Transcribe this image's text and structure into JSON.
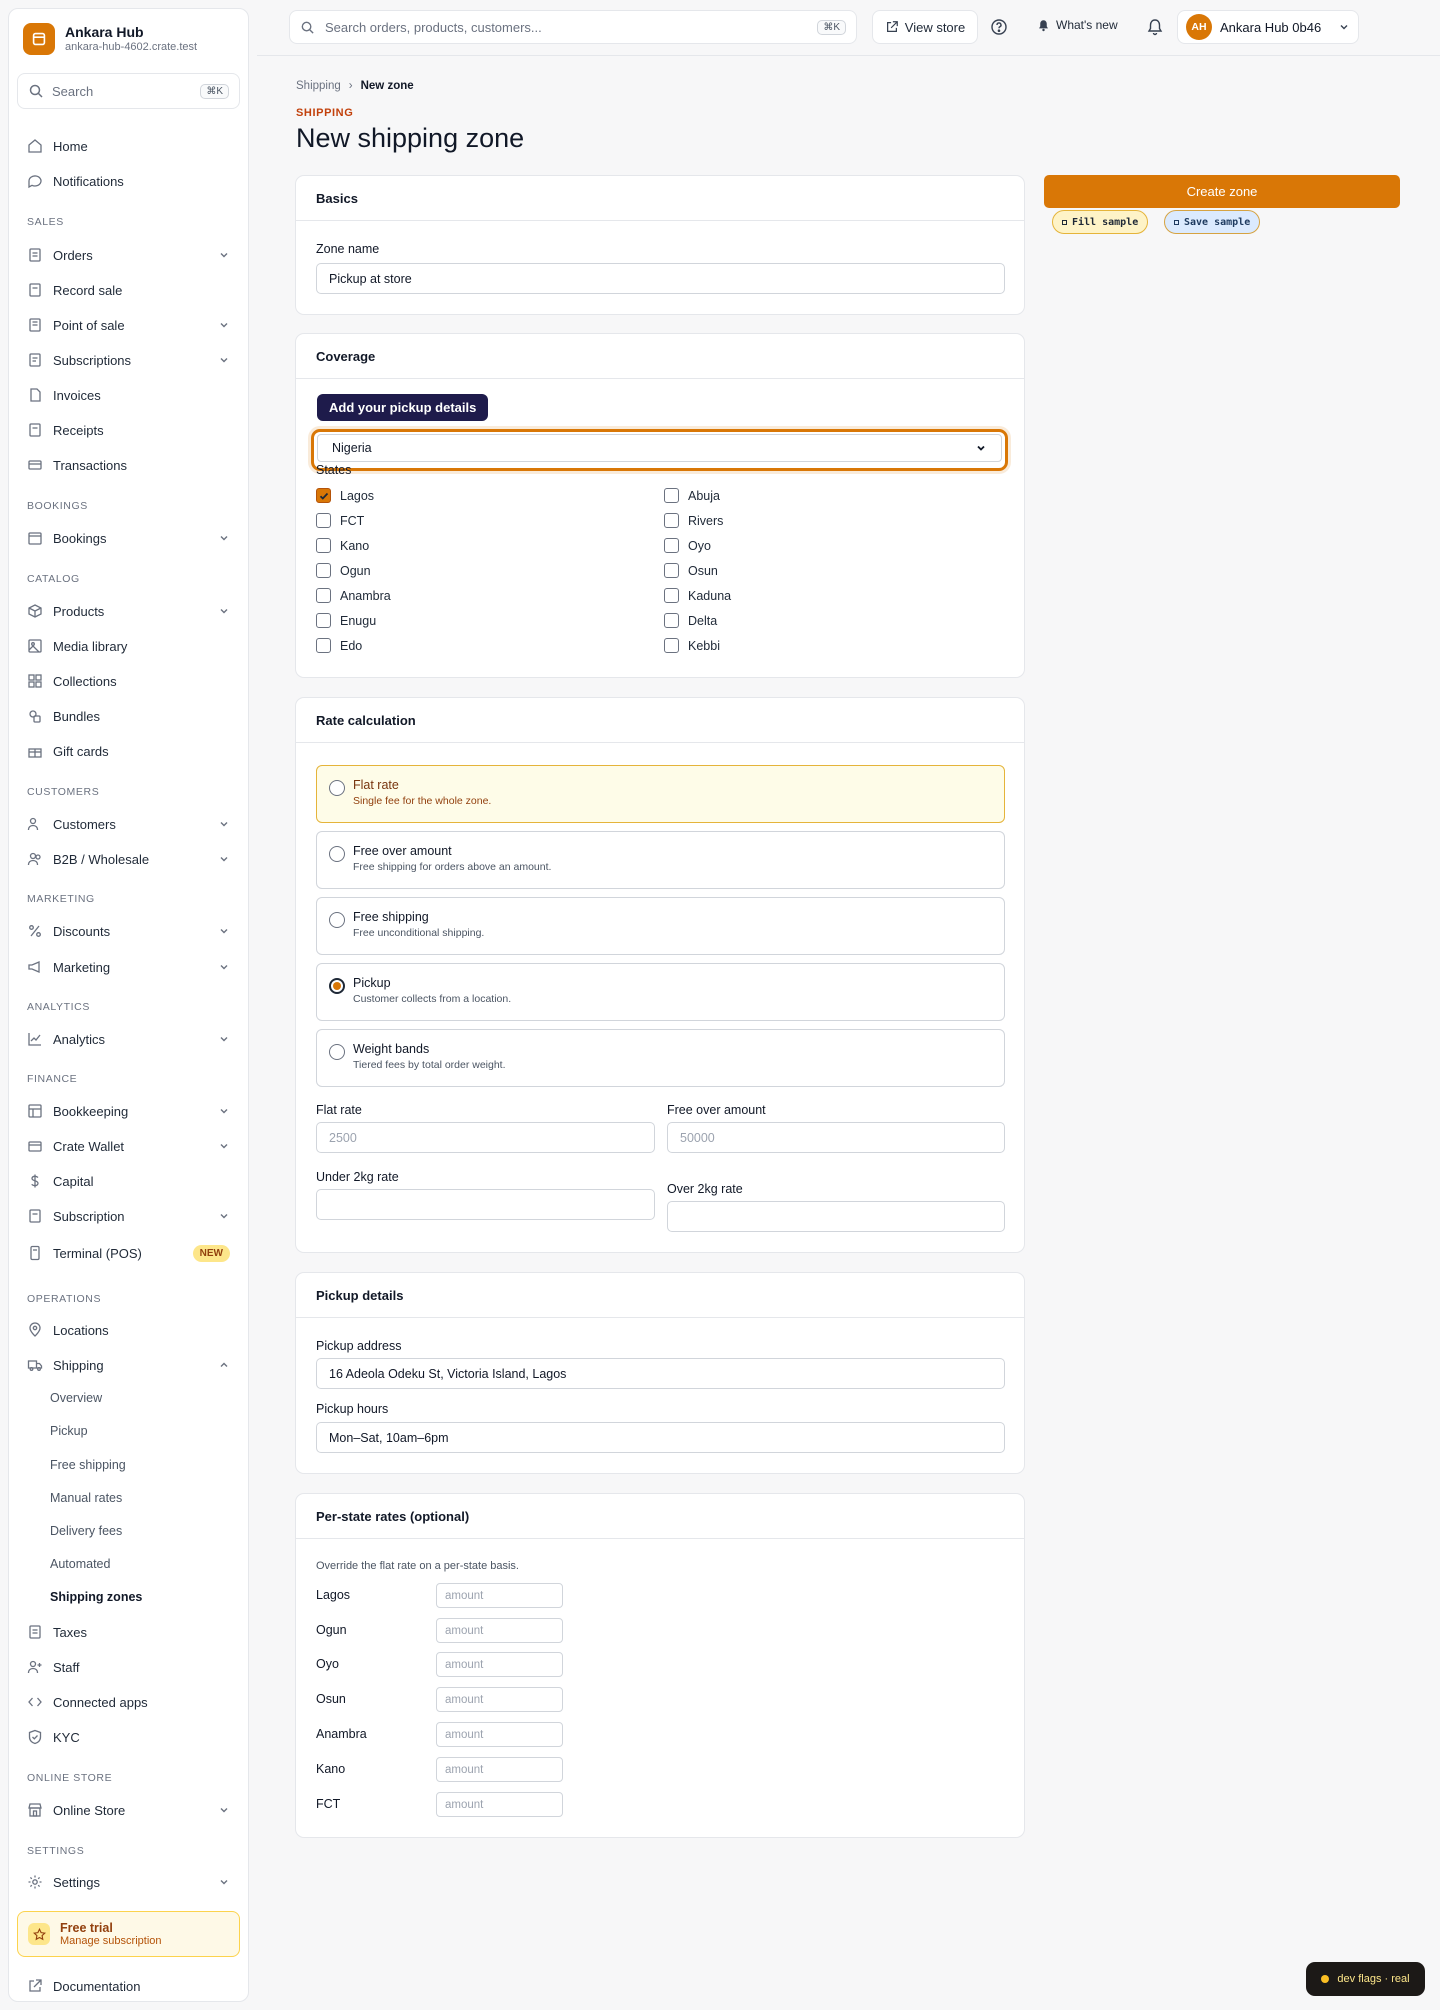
{
  "brand": {
    "name": "Ankara Hub",
    "url": "ankara-hub-4602.crate.test"
  },
  "sidebar_search": {
    "placeholder": "Search",
    "shortcut": "⌘K"
  },
  "nav": {
    "home": "Home",
    "notifications": "Notifications",
    "sec_sales": "SALES",
    "orders": "Orders",
    "record_sale": "Record sale",
    "point_of_sale": "Point of sale",
    "subscriptions": "Subscriptions",
    "invoices": "Invoices",
    "receipts": "Receipts",
    "transactions": "Transactions",
    "sec_bookings": "BOOKINGS",
    "bookings": "Bookings",
    "sec_catalog": "CATALOG",
    "products": "Products",
    "media_library": "Media library",
    "collections": "Collections",
    "bundles": "Bundles",
    "gift_cards": "Gift cards",
    "sec_customers": "CUSTOMERS",
    "customers": "Customers",
    "b2b": "B2B / Wholesale",
    "sec_marketing": "MARKETING",
    "discounts": "Discounts",
    "marketing": "Marketing",
    "sec_analytics": "ANALYTICS",
    "analytics": "Analytics",
    "sec_finance": "FINANCE",
    "bookkeeping": "Bookkeeping",
    "crate_wallet": "Crate Wallet",
    "capital": "Capital",
    "subscription": "Subscription",
    "terminal": "Terminal (POS)",
    "terminal_badge": "NEW",
    "sec_operations": "OPERATIONS",
    "locations": "Locations",
    "shipping": "Shipping",
    "shipping_sub": [
      "Overview",
      "Pickup",
      "Free shipping",
      "Manual rates",
      "Delivery fees",
      "Automated",
      "Shipping zones"
    ],
    "taxes": "Taxes",
    "staff": "Staff",
    "connected_apps": "Connected apps",
    "kyc": "KYC",
    "sec_online_store": "ONLINE STORE",
    "online_store": "Online Store",
    "sec_settings": "SETTINGS",
    "settings": "Settings",
    "documentation": "Documentation"
  },
  "trial": {
    "title": "Free trial",
    "subtitle": "Manage subscription"
  },
  "topbar": {
    "search_placeholder": "Search orders, products, customers...",
    "search_shortcut": "⌘K",
    "view_store": "View store",
    "whats_new": "What's new",
    "account_name": "Ankara Hub 0b46",
    "avatar_initials": "AH"
  },
  "breadcrumb": {
    "parent": "Shipping",
    "separator": "›",
    "current": "New zone"
  },
  "page": {
    "eyebrow": "SHIPPING",
    "title": "New shipping zone"
  },
  "basics": {
    "heading": "Basics",
    "zone_name_label": "Zone name",
    "zone_name_value": "Pickup at store"
  },
  "coverage": {
    "heading": "Coverage",
    "tooltip": "Add your pickup details",
    "country": "Nigeria",
    "states_label": "States",
    "states_left": [
      "Lagos",
      "FCT",
      "Kano",
      "Ogun",
      "Anambra",
      "Enugu",
      "Edo"
    ],
    "states_right": [
      "Abuja",
      "Rivers",
      "Oyo",
      "Osun",
      "Kaduna",
      "Delta",
      "Kebbi"
    ],
    "checked": [
      "Lagos"
    ]
  },
  "rate": {
    "heading": "Rate calculation",
    "options": [
      {
        "title": "Flat rate",
        "desc": "Single fee for the whole zone."
      },
      {
        "title": "Free over amount",
        "desc": "Free shipping for orders above an amount."
      },
      {
        "title": "Free shipping",
        "desc": "Free unconditional shipping."
      },
      {
        "title": "Pickup",
        "desc": "Customer collects from a location."
      },
      {
        "title": "Weight bands",
        "desc": "Tiered fees by total order weight."
      }
    ],
    "selected": "Pickup",
    "flat_rate_label": "Flat rate",
    "flat_rate_placeholder": "2500",
    "free_over_label": "Free over amount",
    "free_over_placeholder": "50000",
    "under2_label": "Under 2kg rate",
    "over2_label": "Over 2kg rate"
  },
  "pickup": {
    "heading": "Pickup details",
    "address_label": "Pickup address",
    "address_value": "16 Adeola Odeku St, Victoria Island, Lagos",
    "hours_label": "Pickup hours",
    "hours_value": "Mon–Sat, 10am–6pm"
  },
  "per_state": {
    "heading": "Per-state rates (optional)",
    "note": "Override the flat rate on a per-state basis.",
    "states": [
      "Lagos",
      "Ogun",
      "Oyo",
      "Osun",
      "Anambra",
      "Kano",
      "FCT"
    ],
    "placeholder": "amount"
  },
  "actions": {
    "create": "Create zone",
    "fill_sample": "Fill sample",
    "save_sample": "Save sample"
  },
  "dev_flags": "dev flags · real",
  "colors": {
    "accent": "#d97706",
    "tooltip_bg": "#1e1b4b"
  }
}
